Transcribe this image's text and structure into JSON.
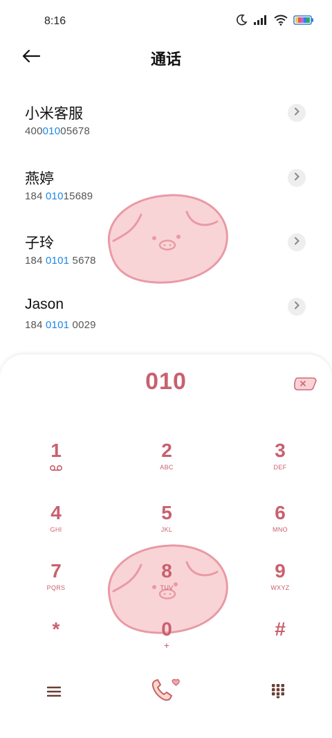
{
  "status_bar": {
    "time": "8:16"
  },
  "header": {
    "title": "通话"
  },
  "contacts": [
    {
      "name": "小米客服",
      "number_pre": "400",
      "number_hl": "010",
      "number_post": "05678"
    },
    {
      "name": "燕婷",
      "number_pre": "184 ",
      "number_hl": "010",
      "number_post": "15689"
    },
    {
      "name": "子玲",
      "number_pre": "184 ",
      "number_hl": "0101",
      "number_post": " 5678"
    },
    {
      "name": "Jason",
      "number_pre": "184 ",
      "number_hl": "0101",
      "number_post": " 0029"
    }
  ],
  "dialpad": {
    "dialed_number": "010",
    "keys": [
      {
        "digit": "1",
        "letters": ""
      },
      {
        "digit": "2",
        "letters": "ABC"
      },
      {
        "digit": "3",
        "letters": "DEF"
      },
      {
        "digit": "4",
        "letters": "GHI"
      },
      {
        "digit": "5",
        "letters": "JKL"
      },
      {
        "digit": "6",
        "letters": "MNO"
      },
      {
        "digit": "7",
        "letters": "PQRS"
      },
      {
        "digit": "8",
        "letters": "TUV"
      },
      {
        "digit": "9",
        "letters": "WXYZ"
      },
      {
        "digit": "*",
        "letters": ""
      },
      {
        "digit": "0",
        "letters": "+"
      },
      {
        "digit": "#",
        "letters": ""
      }
    ]
  },
  "icons": {
    "moon": "moon-icon",
    "signal": "signal-icon",
    "wifi": "wifi-icon",
    "battery": "battery-icon",
    "back": "back-arrow-icon",
    "chevron": "chevron-right-icon",
    "voicemail": "voicemail-icon",
    "delete": "delete-icon",
    "menu": "menu-icon",
    "call": "call-icon",
    "keypad": "keypad-icon"
  },
  "colors": {
    "accent": "#c9606e",
    "highlight": "#1b87e6",
    "pig": "#f8cdd0",
    "pig_outline": "#e89aa4",
    "icon_dark": "#6a3f33"
  }
}
